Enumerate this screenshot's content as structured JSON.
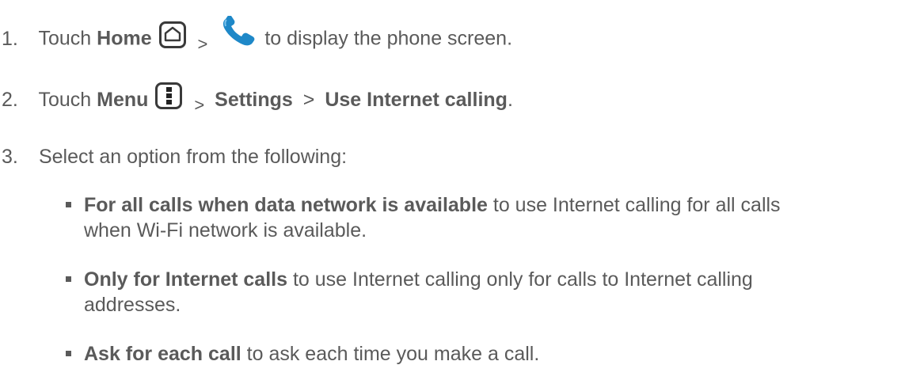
{
  "steps": [
    {
      "num": "1.",
      "pre": "Touch ",
      "bold1": "Home",
      "sep": ">",
      "post": "to display the phone screen."
    },
    {
      "num": "2.",
      "pre": "Touch ",
      "bold1": "Menu",
      "sep1": ">",
      "bold2": "Settings",
      "sep2": ">",
      "bold3": "Use Internet calling",
      "end": "."
    },
    {
      "num": "3.",
      "text": "Select an option from the following:"
    }
  ],
  "options": [
    {
      "bold": "For all calls when data network is available",
      "line1_rest": " to use Internet calling for all calls",
      "line2": "when Wi-Fi network is available."
    },
    {
      "bold": "Only for Internet calls",
      "line1_rest": " to use Internet calling only for calls to Internet calling",
      "line2": "addresses."
    },
    {
      "bold": "Ask for each call",
      "line1_rest": " to ask each time you make a call."
    }
  ],
  "icons": {
    "home": "home-icon",
    "phone": "phone-icon",
    "menu": "menu-icon"
  },
  "colors": {
    "text": "#5a5a5a",
    "phone_icon": "#1e88c8"
  }
}
